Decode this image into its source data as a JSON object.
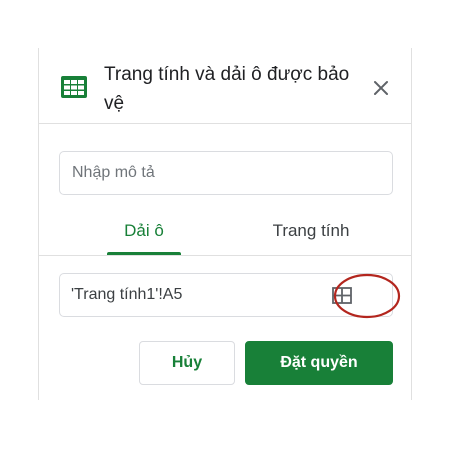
{
  "panel": {
    "title": "Trang tính và dải ô được bảo vệ",
    "app_icon": "google-sheets-icon",
    "close_icon": "close-icon"
  },
  "description": {
    "placeholder": "Nhập mô tả",
    "value": ""
  },
  "tabs": [
    {
      "label": "Dải ô",
      "active": true
    },
    {
      "label": "Trang tính",
      "active": false
    }
  ],
  "range": {
    "value": "'Trang tính1'!A5",
    "picker_icon": "grid-select-range-icon"
  },
  "buttons": {
    "cancel_label": "Hủy",
    "submit_label": "Đặt quyền"
  },
  "colors": {
    "accent": "#188038",
    "highlight_ring": "#b3261e",
    "border": "#dadce0"
  }
}
